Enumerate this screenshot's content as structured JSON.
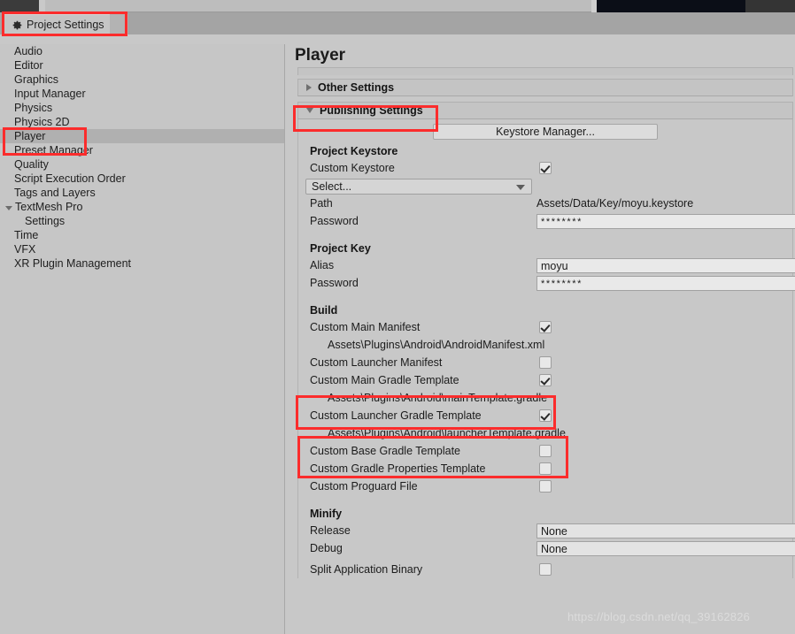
{
  "window": {
    "tab_label": "Project Settings",
    "tab_icon": "gear-icon"
  },
  "sidebar": {
    "items": [
      {
        "label": "Audio",
        "selected": false,
        "expandable": false,
        "child": false
      },
      {
        "label": "Editor",
        "selected": false,
        "expandable": false,
        "child": false
      },
      {
        "label": "Graphics",
        "selected": false,
        "expandable": false,
        "child": false
      },
      {
        "label": "Input Manager",
        "selected": false,
        "expandable": false,
        "child": false
      },
      {
        "label": "Physics",
        "selected": false,
        "expandable": false,
        "child": false
      },
      {
        "label": "Physics 2D",
        "selected": false,
        "expandable": false,
        "child": false
      },
      {
        "label": "Player",
        "selected": true,
        "expandable": false,
        "child": false
      },
      {
        "label": "Preset Manager",
        "selected": false,
        "expandable": false,
        "child": false
      },
      {
        "label": "Quality",
        "selected": false,
        "expandable": false,
        "child": false
      },
      {
        "label": "Script Execution Order",
        "selected": false,
        "expandable": false,
        "child": false
      },
      {
        "label": "Tags and Layers",
        "selected": false,
        "expandable": false,
        "child": false
      },
      {
        "label": "TextMesh Pro",
        "selected": false,
        "expandable": true,
        "child": false
      },
      {
        "label": "Settings",
        "selected": false,
        "expandable": false,
        "child": true
      },
      {
        "label": "Time",
        "selected": false,
        "expandable": false,
        "child": false
      },
      {
        "label": "VFX",
        "selected": false,
        "expandable": false,
        "child": false
      },
      {
        "label": "XR Plugin Management",
        "selected": false,
        "expandable": false,
        "child": false
      }
    ]
  },
  "main": {
    "title": "Player",
    "sections": {
      "other_settings": "Other Settings",
      "publishing_settings": "Publishing Settings"
    },
    "keystore_manager_button": "Keystore Manager...",
    "project_keystore": {
      "title": "Project Keystore",
      "custom_keystore_label": "Custom Keystore",
      "custom_keystore_checked": true,
      "select_dropdown_value": "Select...",
      "path_label": "Path",
      "path_value": "Assets/Data/Key/moyu.keystore",
      "password_label": "Password",
      "password_value": "********"
    },
    "project_key": {
      "title": "Project Key",
      "alias_label": "Alias",
      "alias_value": "moyu",
      "password_label": "Password",
      "password_value": "********"
    },
    "build": {
      "title": "Build",
      "rows": [
        {
          "label": "Custom Main Manifest",
          "checked": true,
          "path": "Assets\\Plugins\\Android\\AndroidManifest.xml"
        },
        {
          "label": "Custom Launcher Manifest",
          "checked": false,
          "path": null
        },
        {
          "label": "Custom Main Gradle Template",
          "checked": true,
          "path": "Assets\\Plugins\\Android\\mainTemplate.gradle"
        },
        {
          "label": "Custom Launcher Gradle Template",
          "checked": true,
          "path": "Assets\\Plugins\\Android\\launcherTemplate.gradle"
        },
        {
          "label": "Custom Base Gradle Template",
          "checked": false,
          "path": null
        },
        {
          "label": "Custom Gradle Properties Template",
          "checked": false,
          "path": null
        },
        {
          "label": "Custom Proguard File",
          "checked": false,
          "path": null
        }
      ]
    },
    "minify": {
      "title": "Minify",
      "release_label": "Release",
      "release_value": "None",
      "debug_label": "Debug",
      "debug_value": "None",
      "split_label": "Split Application Binary",
      "split_checked": false
    }
  },
  "annotations": {
    "highlight_color": "#fb2c2c",
    "boxes": [
      "tab-project-settings",
      "sidebar-player",
      "publishing-settings-header",
      "custom-main-gradle-template",
      "custom-launcher-gradle-template"
    ]
  },
  "watermark": {
    "text": "https://blog.csdn.net/qq_39162826"
  }
}
